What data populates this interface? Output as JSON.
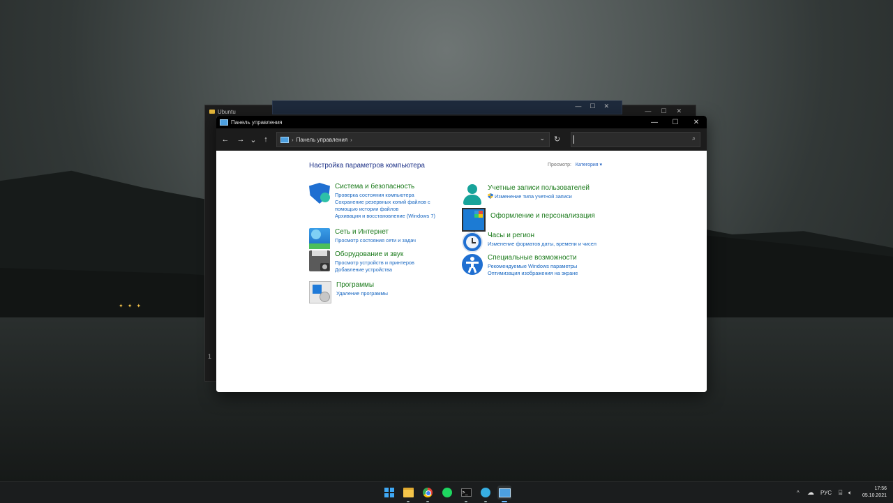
{
  "background_windows": {
    "ubuntu_title": "Ubuntu",
    "ubuntu_side_char": "1"
  },
  "window": {
    "title": "Панель управления",
    "controls": {
      "minimize": "—",
      "maximize": "☐",
      "close": "✕"
    }
  },
  "navbar": {
    "back": "←",
    "forward": "→",
    "recent": "⌄",
    "up": "↑",
    "address": "Панель управления",
    "address_sep_1": "›",
    "address_sep_2": "›",
    "address_dropdown": "⌄",
    "refresh": "↻",
    "search_icon": "⌕"
  },
  "content": {
    "heading": "Настройка параметров компьютера",
    "view_label": "Просмотр:",
    "view_value": "Категория ▾",
    "left": [
      {
        "title": "Система и безопасность",
        "icon": "shield-icon",
        "links": [
          "Проверка состояния компьютера",
          "Сохранение резервных копий файлов с",
          "помощью истории файлов",
          "Архивация и восстановление (Windows 7)"
        ]
      },
      {
        "title": "Сеть и Интернет",
        "icon": "network-icon",
        "links": [
          "Просмотр состояния сети и задач"
        ]
      },
      {
        "title": "Оборудование и звук",
        "icon": "hardware-icon",
        "links": [
          "Просмотр устройств и принтеров",
          "Добавление устройства"
        ]
      },
      {
        "title": "Программы",
        "icon": "programs-icon",
        "links": [
          "Удаление программы"
        ]
      }
    ],
    "right": [
      {
        "title": "Учетные записи пользователей",
        "icon": "user-accounts-icon",
        "links": [
          "Изменение типа учетной записи"
        ]
      },
      {
        "title": "Оформление и персонализация",
        "icon": "personalization-icon",
        "links": []
      },
      {
        "title": "Часы и регион",
        "icon": "clock-region-icon",
        "links": [
          "Изменение форматов даты, времени и чисел"
        ]
      },
      {
        "title": "Специальные возможности",
        "icon": "accessibility-icon",
        "links": [
          "Рекомендуемые Windows параметры",
          "Оптимизация изображения на экране"
        ]
      }
    ]
  },
  "taskbar": {
    "tray_chevron": "^",
    "language": "РУС",
    "time": "17:56",
    "date": "05.10.2021",
    "terminal_glyph": ">_"
  }
}
